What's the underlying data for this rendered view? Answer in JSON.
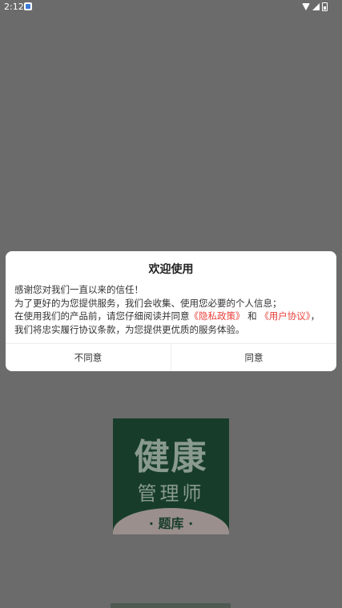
{
  "status_bar": {
    "time": "2:12",
    "icons": [
      "app-notification-icon",
      "wifi-icon",
      "signal-icon",
      "battery-icon"
    ]
  },
  "background": {
    "logo_title": "健康",
    "logo_subtitle": "管理师",
    "logo_badge": "· 题库 ·"
  },
  "dialog": {
    "title": "欢迎使用",
    "line1": "感谢您对我们一直以来的信任！",
    "line2": "为了更好的为您提供服务，我们会收集、使用您必要的个人信息；",
    "line3_prefix": "在使用我们的产品前，请您仔细阅读并同意",
    "privacy_link": "《隐私政策》",
    "and": "和",
    "agreement_link": "《用户协议》",
    "line3_suffix": "，我们将忠实履行协议条款，为您提供更优质的服务体验。",
    "disagree_label": "不同意",
    "agree_label": "同意"
  },
  "colors": {
    "overlay": "#6b6b6b",
    "link": "#e8413b",
    "logo_green": "#173d2a"
  }
}
